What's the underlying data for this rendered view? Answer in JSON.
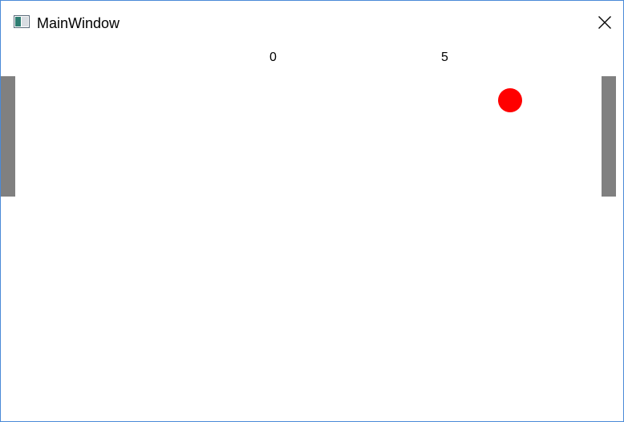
{
  "window": {
    "title": "MainWindow",
    "border_color": "#4a8ad8"
  },
  "titlebar": {
    "app_icon": "window-app-icon",
    "close_icon": "close-icon"
  },
  "game": {
    "score_left": "0",
    "score_right": "5",
    "paddle_color": "#808080",
    "ball_color": "#ff0000"
  }
}
